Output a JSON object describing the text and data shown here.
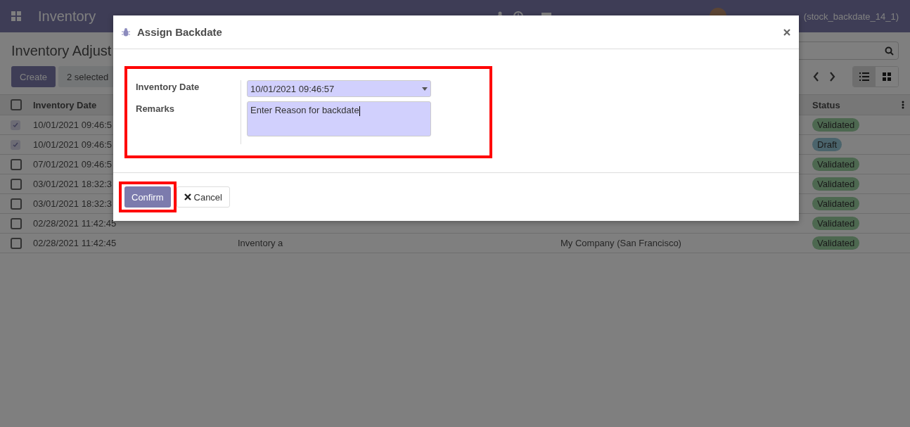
{
  "navbar": {
    "app_title": "Inventory",
    "user": "(stock_backdate_14_1)"
  },
  "control_panel": {
    "title": "Inventory Adjust",
    "create_button": "Create",
    "selection_button": "2 selected"
  },
  "table": {
    "all_selected": false,
    "columns": [
      {
        "label": "Inventory Date"
      },
      {
        "label": "Status"
      }
    ],
    "rows": [
      {
        "selected": true,
        "date": "10/01/2021 09:46:5",
        "status": {
          "label": "Validated",
          "kind": "validated"
        }
      },
      {
        "selected": true,
        "date": "10/01/2021 09:46:5",
        "status": {
          "label": "Draft",
          "kind": "draft"
        }
      },
      {
        "selected": false,
        "date": "07/01/2021 09:46:5",
        "status": {
          "label": "Validated",
          "kind": "validated"
        }
      },
      {
        "selected": false,
        "date": "03/01/2021 18:32:3",
        "status": {
          "label": "Validated",
          "kind": "validated"
        }
      },
      {
        "selected": false,
        "date": "03/01/2021 18:32:3",
        "status": {
          "label": "Validated",
          "kind": "validated"
        }
      },
      {
        "selected": false,
        "date": "02/28/2021 11:42:45",
        "status": {
          "label": "Validated",
          "kind": "validated"
        }
      },
      {
        "selected": false,
        "date": "02/28/2021 11:42:45",
        "reference": "Inventory a",
        "company": "My Company (San Francisco)",
        "status": {
          "label": "Validated",
          "kind": "validated"
        }
      }
    ]
  },
  "dialog": {
    "title": "Assign Backdate",
    "fields": [
      {
        "label": "Inventory Date",
        "kind": "select",
        "value": "10/01/2021 09:46:57"
      },
      {
        "label": "Remarks",
        "kind": "textarea",
        "value": "Enter Reason for backdate"
      }
    ],
    "buttons": [
      {
        "label": "Confirm",
        "kind": "primary"
      },
      {
        "label": "Cancel",
        "kind": "secondary"
      }
    ]
  }
}
